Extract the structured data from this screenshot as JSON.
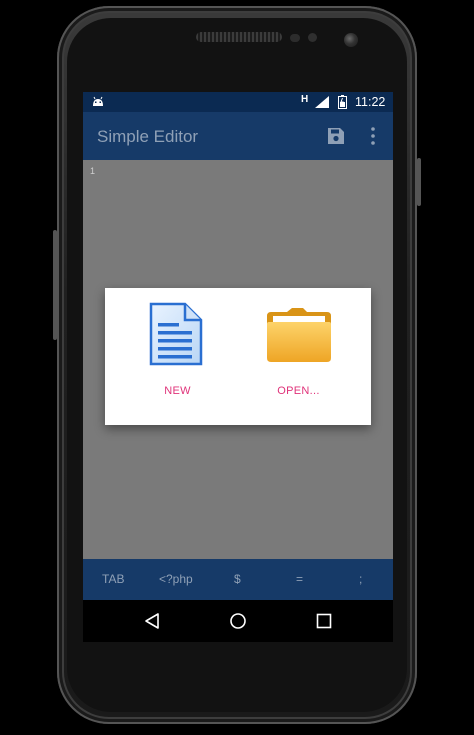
{
  "status_bar": {
    "network_type": "H",
    "time": "11:22",
    "icons": [
      "android-debug-icon",
      "signal-icon",
      "battery-icon"
    ]
  },
  "app_bar": {
    "title": "Simple Editor",
    "actions": [
      "save-icon",
      "more-vert-icon"
    ]
  },
  "editor": {
    "line_numbers": [
      "1"
    ]
  },
  "dialog": {
    "options": [
      {
        "label": "NEW",
        "icon": "new-document-icon"
      },
      {
        "label": "OPEN...",
        "icon": "folder-icon"
      }
    ]
  },
  "bottom_toolbar": {
    "buttons": [
      "TAB",
      "<?php",
      "$",
      "=",
      ";"
    ]
  },
  "nav_bar": {
    "icons": [
      "back-icon",
      "home-icon",
      "recents-icon"
    ]
  },
  "colors": {
    "primary": "#163a68",
    "status_bar": "#0b2a52",
    "accent": "#e0337a",
    "editor_bg": "#7a7a7a",
    "toolbar_text": "#8fa0b6"
  }
}
